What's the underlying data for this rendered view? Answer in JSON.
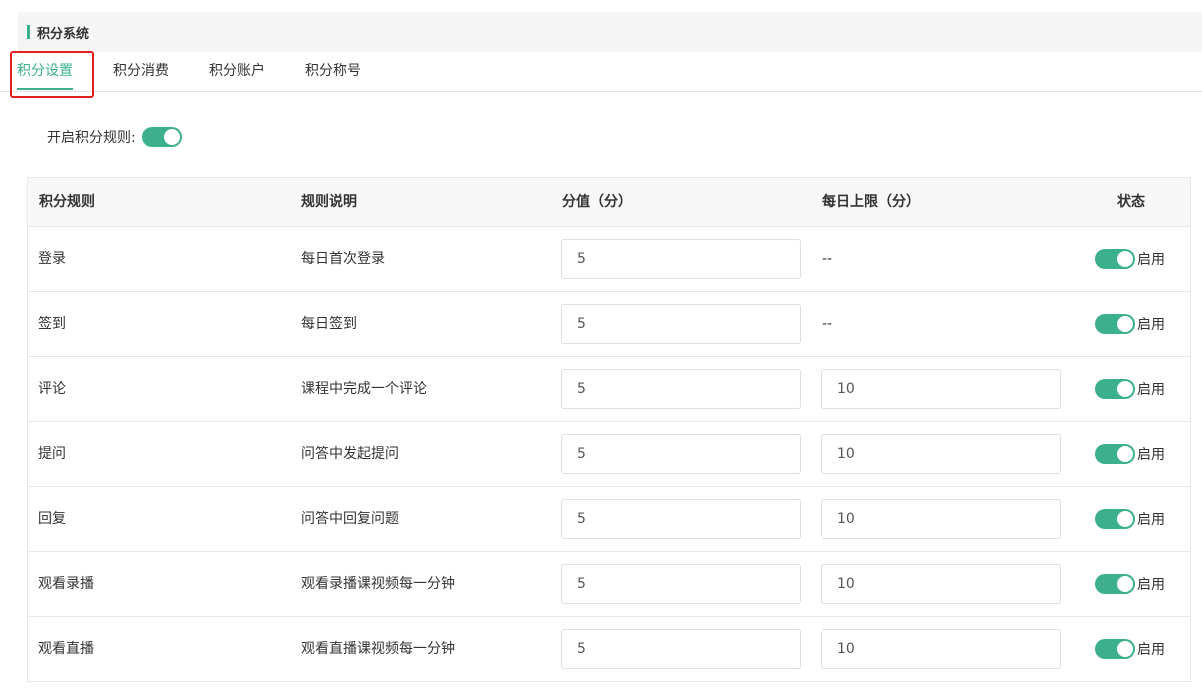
{
  "header": {
    "title": "积分系统"
  },
  "tabs": [
    {
      "label": "积分设置",
      "active": true
    },
    {
      "label": "积分消费",
      "active": false
    },
    {
      "label": "积分账户",
      "active": false
    },
    {
      "label": "积分称号",
      "active": false
    }
  ],
  "rules_toggle": {
    "label": "开启积分规则:",
    "enabled": true
  },
  "table": {
    "headers": {
      "rule": "积分规则",
      "description": "规则说明",
      "points": "分值（分）",
      "daily_limit": "每日上限（分）",
      "status": "状态"
    },
    "rows": [
      {
        "rule": "登录",
        "description": "每日首次登录",
        "points": "5",
        "daily_limit": "--",
        "limit_editable": false,
        "status": "启用"
      },
      {
        "rule": "签到",
        "description": "每日签到",
        "points": "5",
        "daily_limit": "--",
        "limit_editable": false,
        "status": "启用"
      },
      {
        "rule": "评论",
        "description": "课程中完成一个评论",
        "points": "5",
        "daily_limit": "10",
        "limit_editable": true,
        "status": "启用"
      },
      {
        "rule": "提问",
        "description": "问答中发起提问",
        "points": "5",
        "daily_limit": "10",
        "limit_editable": true,
        "status": "启用"
      },
      {
        "rule": "回复",
        "description": "问答中回复问题",
        "points": "5",
        "daily_limit": "10",
        "limit_editable": true,
        "status": "启用"
      },
      {
        "rule": "观看录播",
        "description": "观看录播课视频每一分钟",
        "points": "5",
        "daily_limit": "10",
        "limit_editable": true,
        "status": "启用"
      },
      {
        "rule": "观看直播",
        "description": "观看直播课视频每一分钟",
        "points": "5",
        "daily_limit": "10",
        "limit_editable": true,
        "status": "启用"
      }
    ]
  },
  "colors": {
    "accent": "#3cb08d",
    "highlight": "#e02020"
  }
}
